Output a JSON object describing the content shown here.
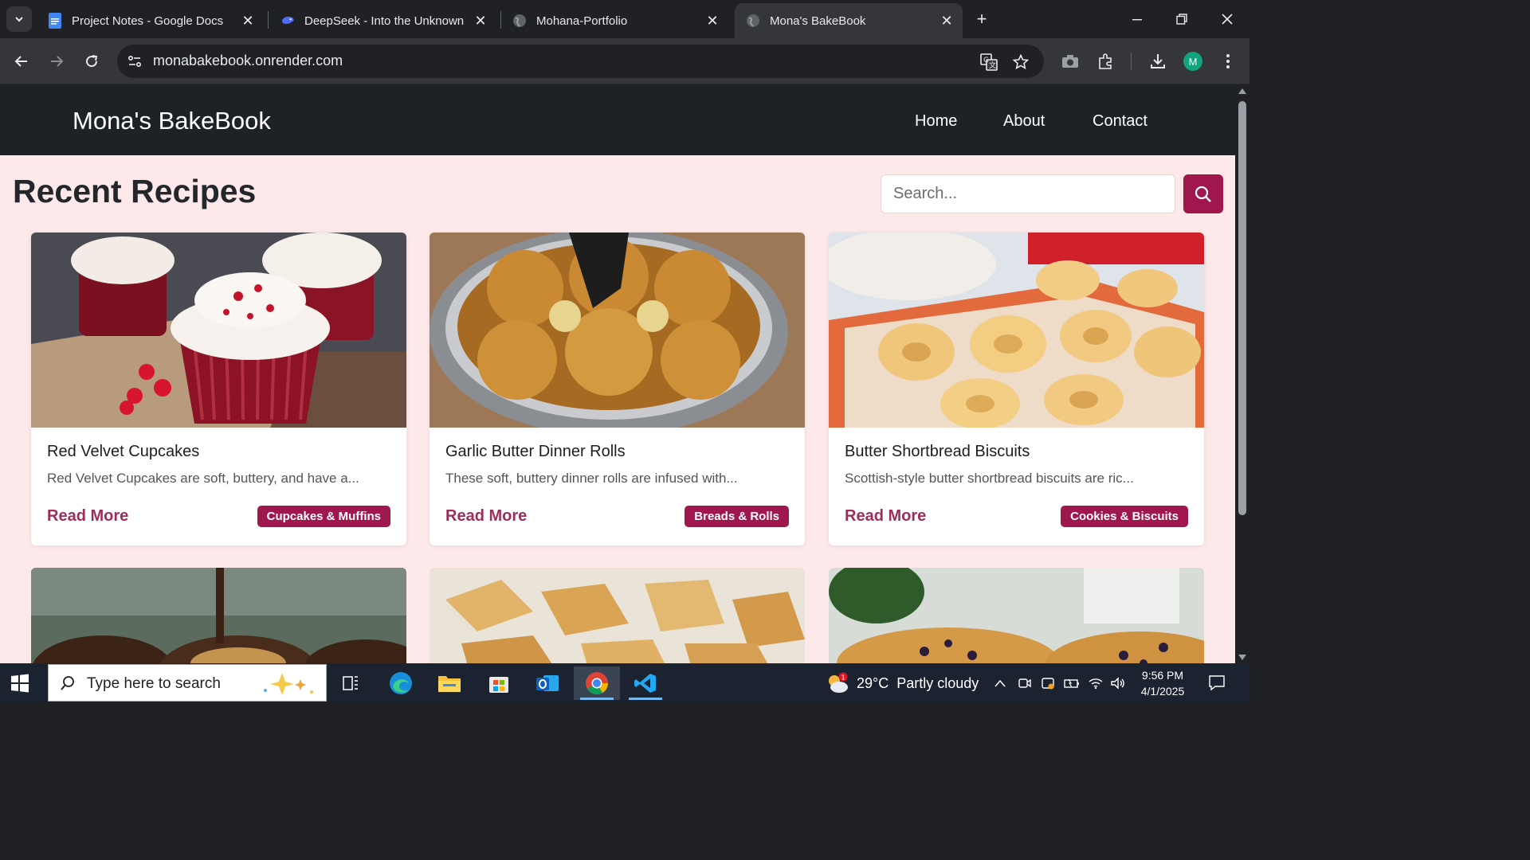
{
  "browser": {
    "tabs": [
      {
        "title": "Project Notes - Google Docs",
        "icon": "google-docs-icon",
        "active": false
      },
      {
        "title": "DeepSeek - Into the Unknown",
        "icon": "deepseek-icon",
        "active": false
      },
      {
        "title": "Mohana-Portfolio",
        "icon": "globe-icon",
        "active": false
      },
      {
        "title": "Mona's BakeBook",
        "icon": "globe-icon",
        "active": true
      }
    ],
    "url": "monabakebook.onrender.com",
    "profile_initial": "M"
  },
  "site": {
    "brand": "Mona's BakeBook",
    "nav": [
      "Home",
      "About",
      "Contact"
    ],
    "page_title": "Recent Recipes",
    "search": {
      "placeholder": "Search..."
    },
    "colors": {
      "accent": "#a0174e",
      "nav_bg": "#1e2227",
      "page_bg": "#fde8ea",
      "link": "#9d2d5a"
    },
    "recipes": [
      {
        "title": "Red Velvet Cupcakes",
        "description": "Red Velvet Cupcakes are soft, buttery, and have a...",
        "link": "Read More",
        "tag": "Cupcakes & Muffins"
      },
      {
        "title": "Garlic Butter Dinner Rolls",
        "description": "These soft, buttery dinner rolls are infused with...",
        "link": "Read More",
        "tag": "Breads & Rolls"
      },
      {
        "title": "Butter Shortbread Biscuits",
        "description": "Scottish-style butter shortbread biscuits are ric...",
        "link": "Read More",
        "tag": "Cookies & Biscuits"
      }
    ]
  },
  "taskbar": {
    "search_placeholder": "Type here to search",
    "weather": {
      "temp": "29°C",
      "condition": "Partly cloudy",
      "badge": "1"
    },
    "time": "9:56 PM",
    "date": "4/1/2025"
  }
}
